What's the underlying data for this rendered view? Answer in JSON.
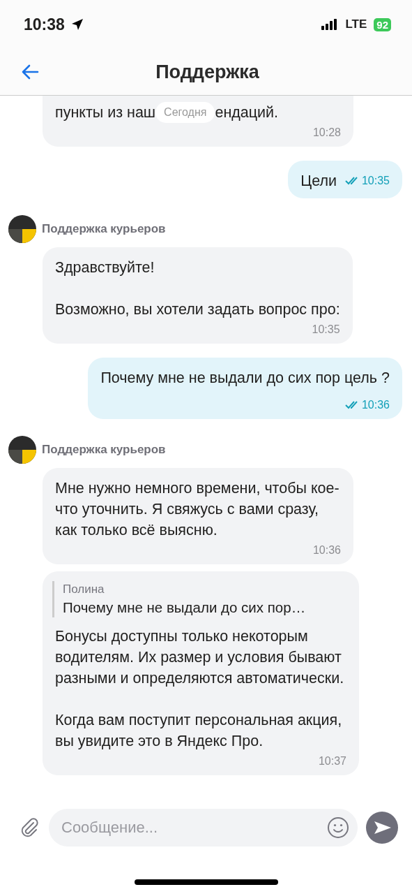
{
  "status_bar": {
    "time": "10:38",
    "network": "LTE",
    "battery": "92"
  },
  "header": {
    "title": "Поддержка"
  },
  "messages": [
    {
      "kind": "partial",
      "outgoing": false,
      "parts": [
        "пункты из наш",
        "ендаций."
      ],
      "date": "Сегодня",
      "time": "10:28"
    },
    {
      "kind": "text",
      "outgoing": true,
      "text": "Цели",
      "read": true,
      "time": "10:35"
    },
    {
      "kind": "sender",
      "name": "Поддержка курьеров"
    },
    {
      "kind": "text",
      "outgoing": false,
      "paragraphs": [
        "Здравствуйте!",
        "Возможно, вы хотели задать вопрос про:"
      ],
      "time": "10:35"
    },
    {
      "kind": "text",
      "outgoing": true,
      "text": "Почему мне не выдали до сих пор цель ?",
      "read": true,
      "time": "10:36"
    },
    {
      "kind": "sender",
      "name": "Поддержка курьеров"
    },
    {
      "kind": "text",
      "outgoing": false,
      "paragraphs": [
        "Мне нужно немного времени, чтобы кое-что уточнить. Я свяжусь с вами сразу, как только всё выясню."
      ],
      "time": "10:36"
    },
    {
      "kind": "reply",
      "outgoing": false,
      "quote": {
        "author": "Полина",
        "text": "Почему мне не выдали до сих пор…"
      },
      "paragraphs": [
        "Бонусы доступны только некоторым водителям. Их размер и условия бывают разными и определяются автоматически.",
        "Когда вам поступит персональная акция, вы увидите это в Яндекс Про."
      ],
      "time": "10:37"
    }
  ],
  "composer": {
    "placeholder": "Сообщение..."
  }
}
